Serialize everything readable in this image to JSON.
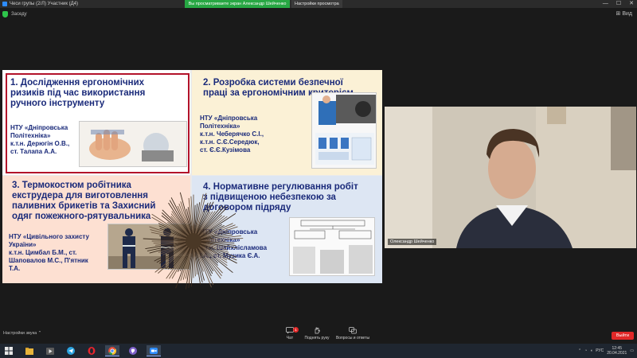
{
  "window": {
    "title": "Чеси групы (2/Л) Участник (Д4)",
    "share_banner": "Вы просматриваете экран Александр Шейченко",
    "share_options": "Настройки просмотра ⌄",
    "controls": [
      "—",
      "☐",
      "✕"
    ]
  },
  "toolbar": {
    "label": "Заседу",
    "view_label": "⊞ Вид"
  },
  "slide": {
    "q1": {
      "title_lines": [
        "1. Дослідження ергономічних",
        "ризиків під час використання",
        "ручного інструменту"
      ],
      "authors": [
        "НТУ «Дніпровська",
        "Політехніка»",
        "к.т.н. Дерюгін О.В.,",
        "ст. Талапа А.А."
      ]
    },
    "q2": {
      "title_lines": [
        "2. Розробка системи безпечної",
        "праці за ергономічним критерієм"
      ],
      "authors": [
        "НТУ «Дніпровська",
        "Політехніка»",
        "к.т.н. Чеберячко С.І.,",
        "к.т.н. С.Є.Середюк,",
        "ст. Є.Є.Кузімова"
      ]
    },
    "q3": {
      "title_lines": [
        "3. Термокостюм робітника",
        "екструдера для виготовлення",
        "паливних брикетів та Захисний",
        "одяг пожежного-рятувальника"
      ],
      "authors": [
        "НТУ «Цивільного захисту",
        "України»",
        "к.т.н. Цимбал Б.М., ст.",
        "Шаповалов М.С., П'ятник",
        "Т.А."
      ]
    },
    "q4": {
      "title_lines": [
        "4. Нормативне регулювання робіт",
        "з підвищеною небезпекою за",
        "договором підряду"
      ],
      "authors": [
        "НТУ «Дніпровська",
        "Політехніка»",
        "к.т.н. Шайхлісламова",
        "І.А., ст. Музика Є.А."
      ]
    }
  },
  "video": {
    "participant_name": "Олександр Шейченко"
  },
  "bottom_bar": {
    "audio_label": "Настройки звука ⌃",
    "chat_label": "Чат",
    "chat_badge": "1",
    "raise_hand_label": "Поднять руку",
    "qa_label": "Вопросы и ответы",
    "leave_label": "Выйти"
  },
  "taskbar": {
    "time": "12:45",
    "date": "20.04.2021",
    "tray_lang": "РУС"
  },
  "colors": {
    "accent": "#2d8cff",
    "share_green": "#27a743",
    "leave_red": "#e02828",
    "title_blue": "#1a2a7a",
    "frame_red": "#b3122a"
  }
}
